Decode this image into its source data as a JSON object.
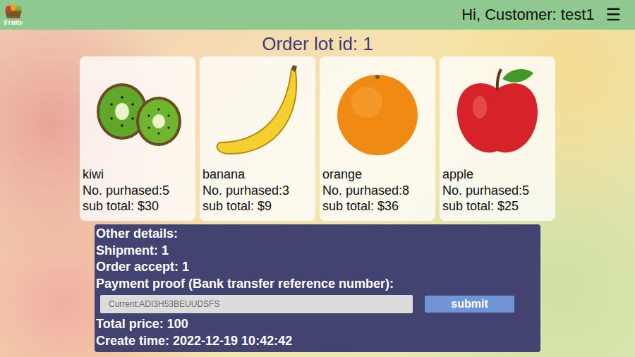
{
  "header": {
    "logo": "Fruity",
    "greeting": "Hi, Customer: test1",
    "menu": "☰"
  },
  "title": "Order lot id: 1",
  "items": [
    {
      "name": "kiwi",
      "purchased": "No. purhased:5",
      "subtotal": "sub total: $30"
    },
    {
      "name": "banana",
      "purchased": "No. purhased:3",
      "subtotal": "sub total: $9"
    },
    {
      "name": "orange",
      "purchased": "No. purhased:8",
      "subtotal": "sub total: $36"
    },
    {
      "name": "apple",
      "purchased": "No. purhased:5",
      "subtotal": "sub total: $25"
    }
  ],
  "details": {
    "heading": "Other details:",
    "shipment": "Shipment: 1",
    "accept": "Order accept: 1",
    "payment_label": "Payment proof (Bank transfer reference number):",
    "payment_placeholder": "Current:ADI3H53BEUUDSFS",
    "submit": "submit",
    "total": "Total price: 100",
    "created": "Create time: 2022-12-19 10:42:42"
  }
}
